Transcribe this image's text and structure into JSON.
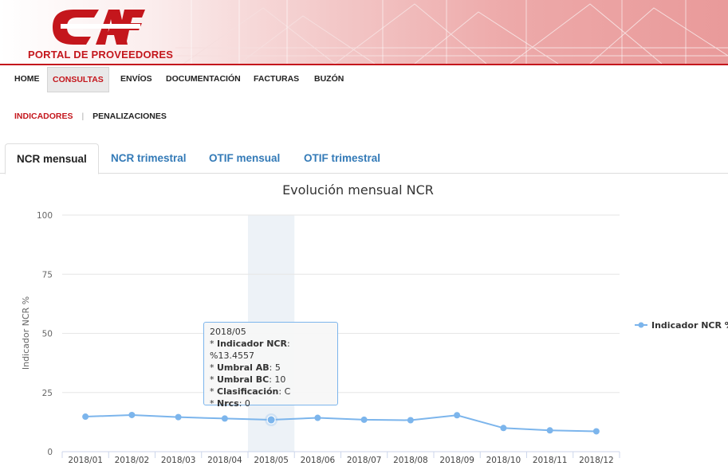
{
  "header": {
    "logo_text": "CAF",
    "portal_title": "PORTAL DE PROVEEDORES"
  },
  "nav": {
    "items": [
      "HOME",
      "CONSULTAS",
      "ENVÍOS",
      "DOCUMENTACIÓN",
      "FACTURAS",
      "BUZÓN"
    ],
    "active": "CONSULTAS"
  },
  "subnav": {
    "items": [
      "INDICADORES",
      "PENALIZACIONES"
    ],
    "separator": "|",
    "active": "INDICADORES"
  },
  "tabs": {
    "items": [
      "NCR mensual",
      "NCR trimestral",
      "OTIF mensual",
      "OTIF trimestral"
    ],
    "active": "NCR mensual"
  },
  "colors": {
    "brand_red": "#c4161c",
    "series": "#7cb5ec",
    "link_blue": "#337ab7",
    "highlight_band": "#e6ecf4"
  },
  "chart_data": {
    "type": "line",
    "title": "Evolución mensual NCR",
    "ylabel": "Indicador NCR %",
    "xlabel": "",
    "ylim": [
      0,
      100
    ],
    "yticks": [
      0,
      25,
      50,
      75,
      100
    ],
    "grid": true,
    "legend_position": "right",
    "categories": [
      "2018/01",
      "2018/02",
      "2018/03",
      "2018/04",
      "2018/05",
      "2018/06",
      "2018/07",
      "2018/08",
      "2018/09",
      "2018/10",
      "2018/11",
      "2018/12"
    ],
    "series": [
      {
        "name": "Indicador NCR %",
        "values": [
          14.8,
          15.5,
          14.6,
          14.0,
          13.4557,
          14.3,
          13.5,
          13.3,
          15.4,
          10.0,
          9.0,
          8.6
        ]
      }
    ],
    "highlight_category": "2018/05",
    "tooltip": {
      "category": "2018/05",
      "lines": [
        {
          "label": "Indicador NCR",
          "value": "%13.4557"
        },
        {
          "label": "Umbral AB",
          "value": "5"
        },
        {
          "label": "Umbral BC",
          "value": "10"
        },
        {
          "label": "Clasificación",
          "value": "C"
        },
        {
          "label": "Nrcs",
          "value": "0"
        }
      ]
    }
  }
}
